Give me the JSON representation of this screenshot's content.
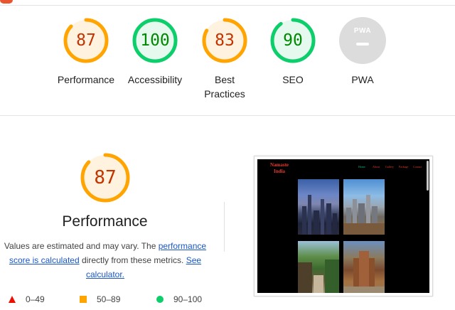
{
  "categories": [
    {
      "score": "87",
      "label": "Performance",
      "fraction": 0.87,
      "color": "#ffa400",
      "text_color": "#c33300",
      "bg": "#fff3e0"
    },
    {
      "score": "100",
      "label": "Accessibility",
      "fraction": 1.0,
      "color": "#0cce6b",
      "text_color": "#008800",
      "bg": "#e6f9ee"
    },
    {
      "score": "83",
      "label_line1": "Best",
      "label_line2": "Practices",
      "fraction": 0.83,
      "color": "#ffa400",
      "text_color": "#c33300",
      "bg": "#fff3e0"
    },
    {
      "score": "90",
      "label": "SEO",
      "fraction": 0.9,
      "color": "#0cce6b",
      "text_color": "#008800",
      "bg": "#e6f9ee"
    },
    {
      "badge_text": "PWA",
      "label": "PWA"
    }
  ],
  "performance": {
    "score": "87",
    "fraction": 0.87,
    "title": "Performance",
    "desc_part1": "Values are estimated and may vary. The ",
    "link1": "performance score is calculated",
    "desc_part2": " directly from these metrics. ",
    "link2": "See calculator."
  },
  "legend": [
    {
      "range": "0–49",
      "shape": "triangle",
      "color": "#eb0f00"
    },
    {
      "range": "50–89",
      "shape": "square",
      "color": "#ffa400"
    },
    {
      "range": "90–100",
      "shape": "circle",
      "color": "#0cce6b"
    }
  ],
  "preview": {
    "brand_line1": "Namaste",
    "brand_line2": "India",
    "nav": [
      "Home",
      "About",
      "Gallery",
      "Package",
      "Contact"
    ],
    "active_color": "#1fb08a",
    "nav_color": "#e23a2a"
  }
}
